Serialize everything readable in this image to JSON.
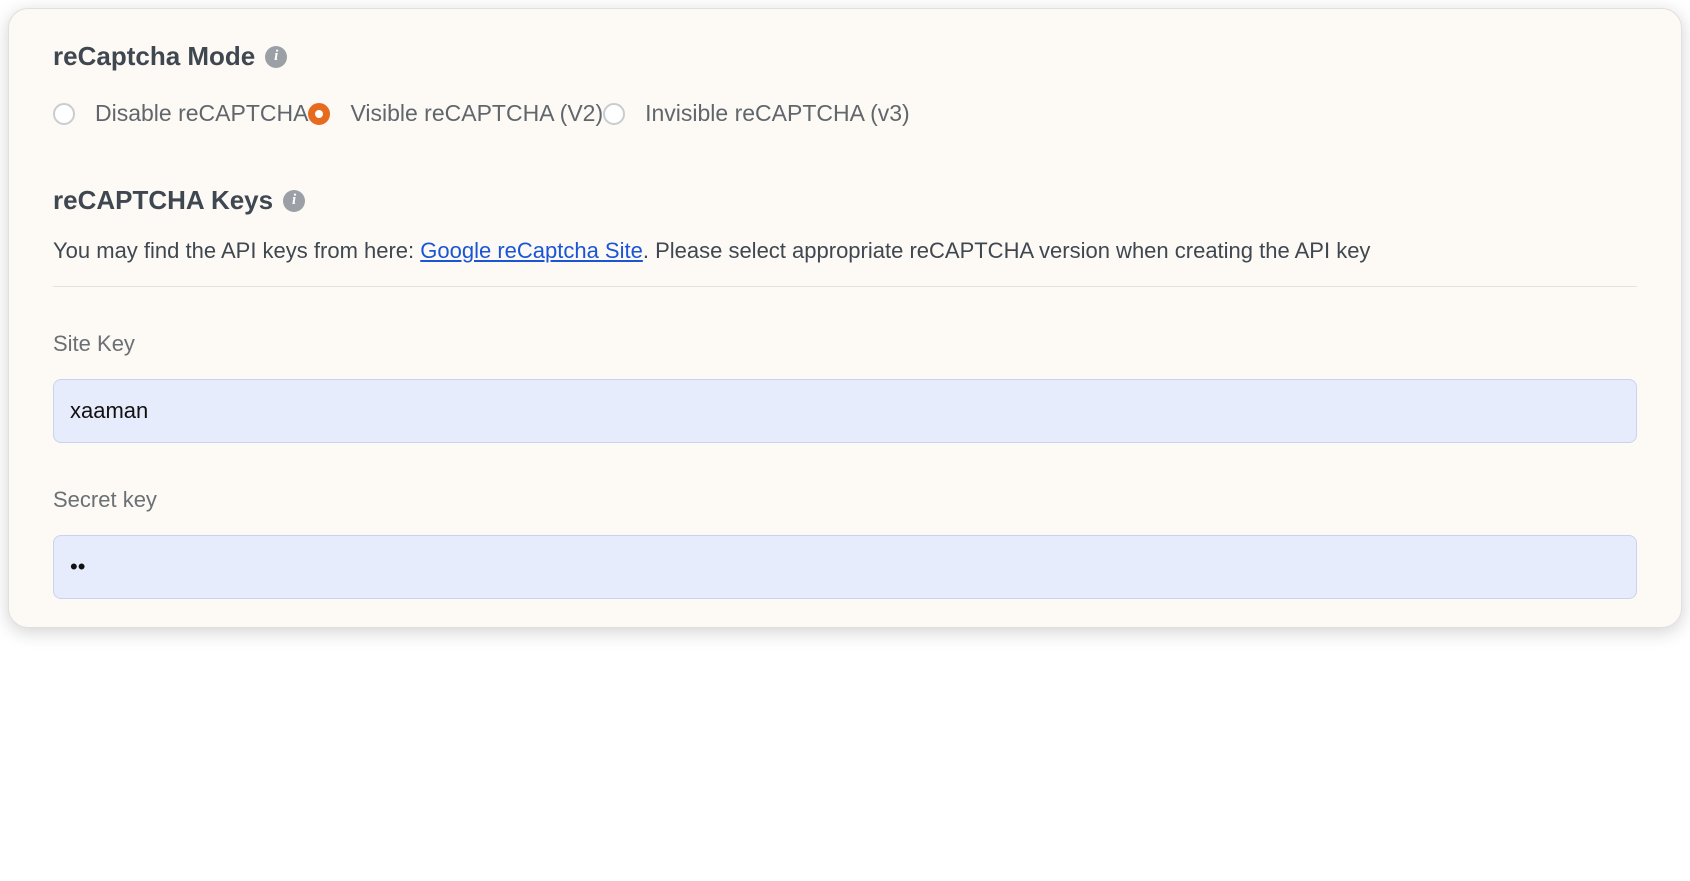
{
  "mode": {
    "heading": "reCaptcha Mode",
    "options": [
      {
        "label": "Disable reCAPTCHA",
        "selected": false
      },
      {
        "label": "Visible reCAPTCHA (V2)",
        "selected": true
      },
      {
        "label": "Invisible reCAPTCHA (v3)",
        "selected": false
      }
    ]
  },
  "keys": {
    "heading": "reCAPTCHA Keys",
    "helper_before": "You may find the API keys from here: ",
    "helper_link": "Google reCaptcha Site",
    "helper_after": ". Please select appropriate reCAPTCHA version when creating the API key",
    "site_key_label": "Site Key",
    "site_key_value": "xaaman",
    "secret_key_label": "Secret key",
    "secret_key_value": "••"
  }
}
